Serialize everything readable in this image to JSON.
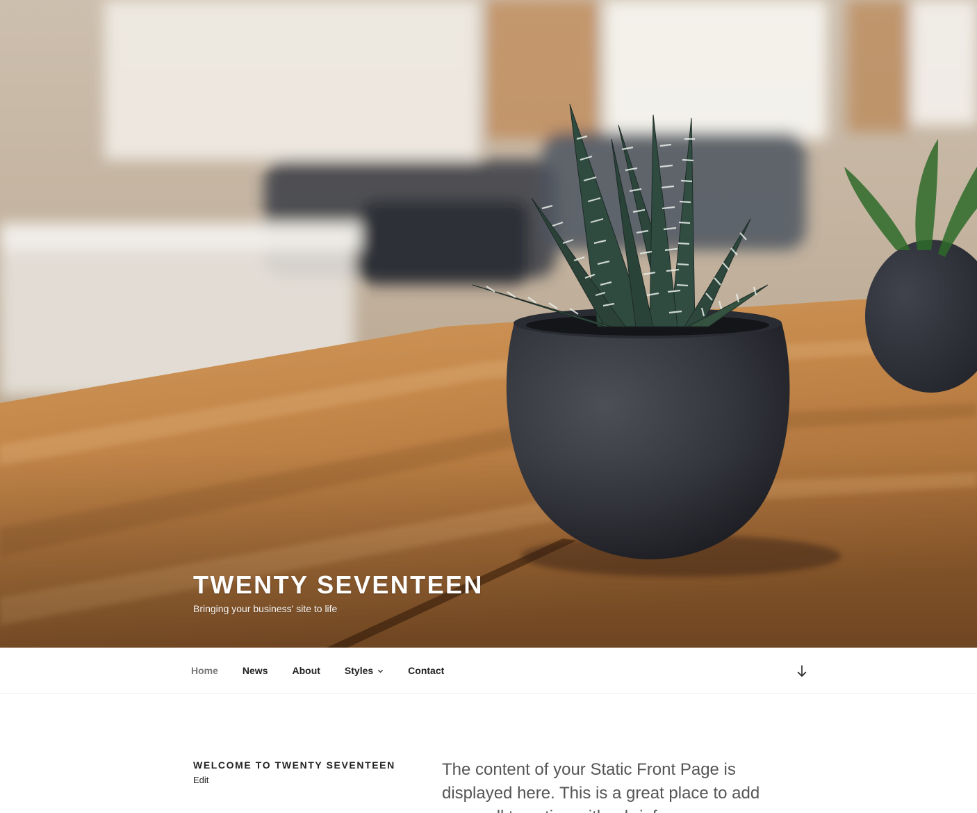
{
  "header": {
    "site_title": "TWENTY SEVENTEEN",
    "site_description": "Bringing your business' site to life"
  },
  "nav": {
    "items": [
      {
        "label": "Home",
        "current": true
      },
      {
        "label": "News"
      },
      {
        "label": "About"
      },
      {
        "label": "Styles",
        "has_submenu": true
      },
      {
        "label": "Contact"
      }
    ],
    "scroll_icon": "arrow-down-icon",
    "submenu_icon": "chevron-down-icon"
  },
  "page": {
    "title": "WELCOME TO TWENTY SEVENTEEN",
    "edit_label": "Edit",
    "body_text": "The content of your Static Front Page is displayed here. This is a great place to add your call to action with a brief message"
  },
  "colors": {
    "text_dark": "#222222",
    "text_current_nav": "#767676",
    "body_text": "#555555",
    "title_white": "#ffffff"
  }
}
